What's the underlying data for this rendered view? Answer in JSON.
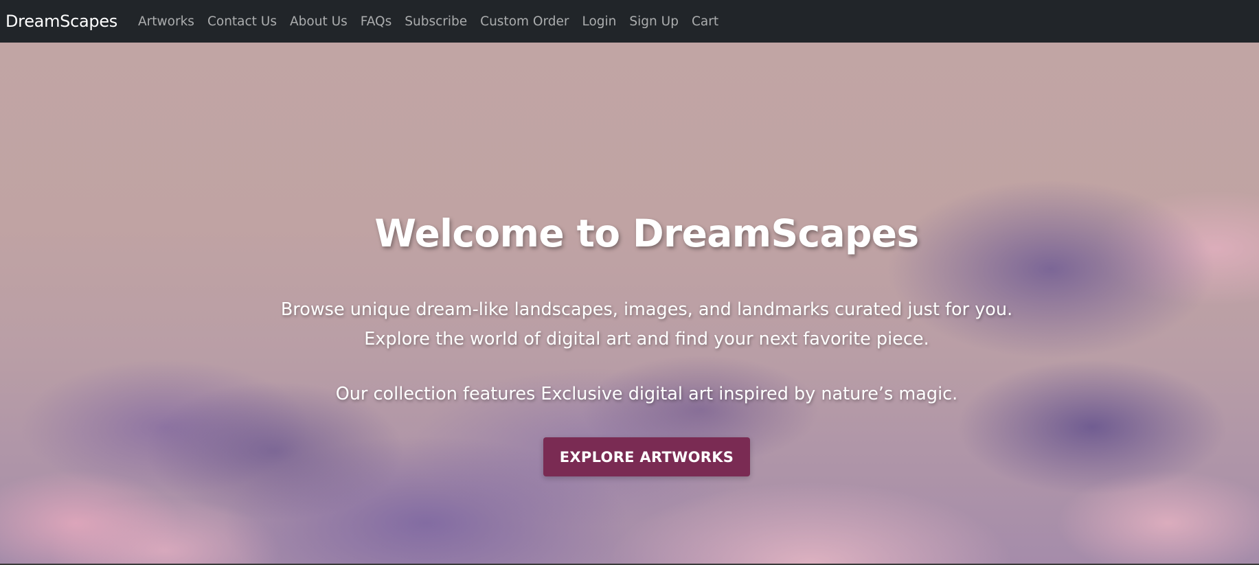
{
  "navbar": {
    "brand": "DreamScapes",
    "links": [
      {
        "label": "Artworks"
      },
      {
        "label": "Contact Us"
      },
      {
        "label": "About Us"
      },
      {
        "label": "FAQs"
      },
      {
        "label": "Subscribe"
      },
      {
        "label": "Custom Order"
      },
      {
        "label": "Login"
      },
      {
        "label": "Sign Up"
      },
      {
        "label": "Cart"
      }
    ]
  },
  "hero": {
    "title": "Welcome to DreamScapes",
    "paragraph1_line1": "Browse unique dream-like landscapes, images, and landmarks curated just for you.",
    "paragraph1_line2": "Explore the world of digital art and find your next favorite piece.",
    "paragraph2": "Our collection features Exclusive digital art inspired by nature’s magic.",
    "button_label": "EXPLORE ARTWORKS",
    "background_image": "cloudy-sky-background"
  },
  "colors": {
    "navbar_bg": "#212529",
    "brand_text": "#ffffff",
    "nav_link": "#9a9c9f",
    "button_bg": "#7a2b53",
    "hero_text": "#ffffff"
  }
}
